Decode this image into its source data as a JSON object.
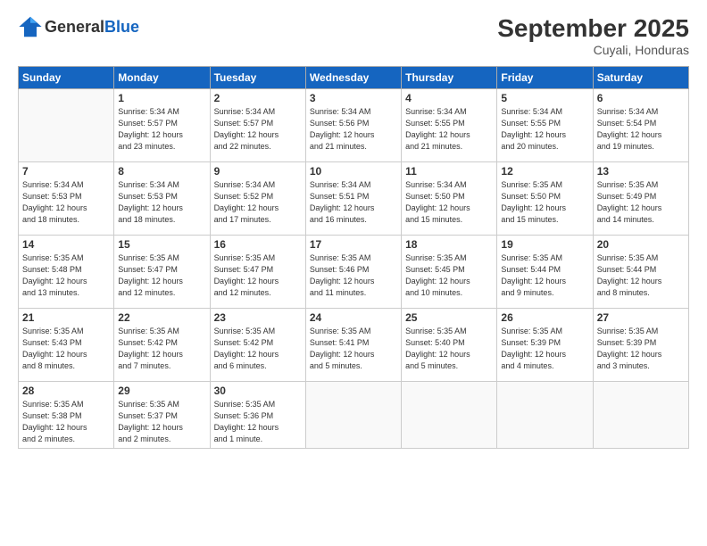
{
  "header": {
    "logo_general": "General",
    "logo_blue": "Blue",
    "month_title": "September 2025",
    "location": "Cuyali, Honduras"
  },
  "weekdays": [
    "Sunday",
    "Monday",
    "Tuesday",
    "Wednesday",
    "Thursday",
    "Friday",
    "Saturday"
  ],
  "days": [
    {
      "num": "",
      "info": ""
    },
    {
      "num": "1",
      "info": "Sunrise: 5:34 AM\nSunset: 5:57 PM\nDaylight: 12 hours\nand 23 minutes."
    },
    {
      "num": "2",
      "info": "Sunrise: 5:34 AM\nSunset: 5:57 PM\nDaylight: 12 hours\nand 22 minutes."
    },
    {
      "num": "3",
      "info": "Sunrise: 5:34 AM\nSunset: 5:56 PM\nDaylight: 12 hours\nand 21 minutes."
    },
    {
      "num": "4",
      "info": "Sunrise: 5:34 AM\nSunset: 5:55 PM\nDaylight: 12 hours\nand 21 minutes."
    },
    {
      "num": "5",
      "info": "Sunrise: 5:34 AM\nSunset: 5:55 PM\nDaylight: 12 hours\nand 20 minutes."
    },
    {
      "num": "6",
      "info": "Sunrise: 5:34 AM\nSunset: 5:54 PM\nDaylight: 12 hours\nand 19 minutes."
    },
    {
      "num": "7",
      "info": "Sunrise: 5:34 AM\nSunset: 5:53 PM\nDaylight: 12 hours\nand 18 minutes."
    },
    {
      "num": "8",
      "info": "Sunrise: 5:34 AM\nSunset: 5:53 PM\nDaylight: 12 hours\nand 18 minutes."
    },
    {
      "num": "9",
      "info": "Sunrise: 5:34 AM\nSunset: 5:52 PM\nDaylight: 12 hours\nand 17 minutes."
    },
    {
      "num": "10",
      "info": "Sunrise: 5:34 AM\nSunset: 5:51 PM\nDaylight: 12 hours\nand 16 minutes."
    },
    {
      "num": "11",
      "info": "Sunrise: 5:34 AM\nSunset: 5:50 PM\nDaylight: 12 hours\nand 15 minutes."
    },
    {
      "num": "12",
      "info": "Sunrise: 5:35 AM\nSunset: 5:50 PM\nDaylight: 12 hours\nand 15 minutes."
    },
    {
      "num": "13",
      "info": "Sunrise: 5:35 AM\nSunset: 5:49 PM\nDaylight: 12 hours\nand 14 minutes."
    },
    {
      "num": "14",
      "info": "Sunrise: 5:35 AM\nSunset: 5:48 PM\nDaylight: 12 hours\nand 13 minutes."
    },
    {
      "num": "15",
      "info": "Sunrise: 5:35 AM\nSunset: 5:47 PM\nDaylight: 12 hours\nand 12 minutes."
    },
    {
      "num": "16",
      "info": "Sunrise: 5:35 AM\nSunset: 5:47 PM\nDaylight: 12 hours\nand 12 minutes."
    },
    {
      "num": "17",
      "info": "Sunrise: 5:35 AM\nSunset: 5:46 PM\nDaylight: 12 hours\nand 11 minutes."
    },
    {
      "num": "18",
      "info": "Sunrise: 5:35 AM\nSunset: 5:45 PM\nDaylight: 12 hours\nand 10 minutes."
    },
    {
      "num": "19",
      "info": "Sunrise: 5:35 AM\nSunset: 5:44 PM\nDaylight: 12 hours\nand 9 minutes."
    },
    {
      "num": "20",
      "info": "Sunrise: 5:35 AM\nSunset: 5:44 PM\nDaylight: 12 hours\nand 8 minutes."
    },
    {
      "num": "21",
      "info": "Sunrise: 5:35 AM\nSunset: 5:43 PM\nDaylight: 12 hours\nand 8 minutes."
    },
    {
      "num": "22",
      "info": "Sunrise: 5:35 AM\nSunset: 5:42 PM\nDaylight: 12 hours\nand 7 minutes."
    },
    {
      "num": "23",
      "info": "Sunrise: 5:35 AM\nSunset: 5:42 PM\nDaylight: 12 hours\nand 6 minutes."
    },
    {
      "num": "24",
      "info": "Sunrise: 5:35 AM\nSunset: 5:41 PM\nDaylight: 12 hours\nand 5 minutes."
    },
    {
      "num": "25",
      "info": "Sunrise: 5:35 AM\nSunset: 5:40 PM\nDaylight: 12 hours\nand 5 minutes."
    },
    {
      "num": "26",
      "info": "Sunrise: 5:35 AM\nSunset: 5:39 PM\nDaylight: 12 hours\nand 4 minutes."
    },
    {
      "num": "27",
      "info": "Sunrise: 5:35 AM\nSunset: 5:39 PM\nDaylight: 12 hours\nand 3 minutes."
    },
    {
      "num": "28",
      "info": "Sunrise: 5:35 AM\nSunset: 5:38 PM\nDaylight: 12 hours\nand 2 minutes."
    },
    {
      "num": "29",
      "info": "Sunrise: 5:35 AM\nSunset: 5:37 PM\nDaylight: 12 hours\nand 2 minutes."
    },
    {
      "num": "30",
      "info": "Sunrise: 5:35 AM\nSunset: 5:36 PM\nDaylight: 12 hours\nand 1 minute."
    },
    {
      "num": "",
      "info": ""
    },
    {
      "num": "",
      "info": ""
    },
    {
      "num": "",
      "info": ""
    },
    {
      "num": "",
      "info": ""
    }
  ]
}
